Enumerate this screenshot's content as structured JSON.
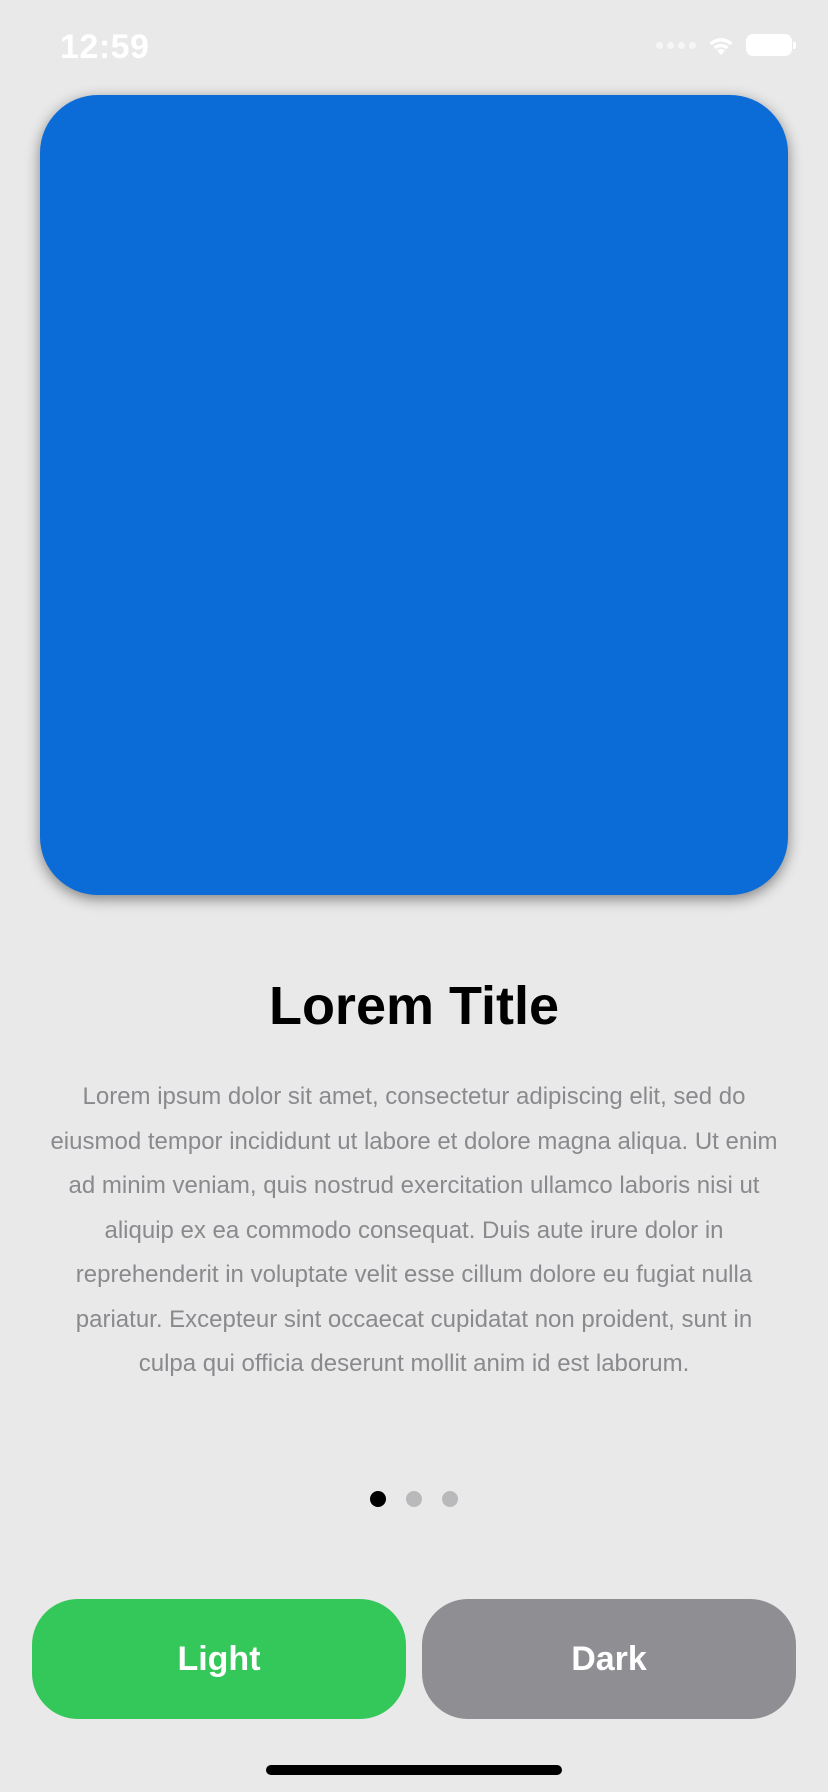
{
  "status_bar": {
    "time": "12:59",
    "icons": [
      "cellular-signal-icon",
      "wifi-icon",
      "battery-icon"
    ]
  },
  "hero": {
    "color": "#0b6cd8"
  },
  "content": {
    "title": "Lorem Title",
    "body": "Lorem ipsum dolor sit amet, consectetur adipiscing elit, sed do eiusmod tempor incididunt ut labore et dolore magna aliqua. Ut enim ad minim veniam, quis nostrud exercitation ullamco laboris nisi ut aliquip ex ea commodo consequat. Duis aute irure dolor in reprehenderit in voluptate velit esse cillum dolore eu fugiat nulla pariatur. Excepteur sint occaecat cupidatat non proident, sunt in culpa qui officia deserunt mollit anim id est laborum."
  },
  "pager": {
    "count": 3,
    "active_index": 0
  },
  "buttons": {
    "light_label": "Light",
    "dark_label": "Dark",
    "light_color": "#34c759",
    "dark_color": "#8e8e93"
  }
}
